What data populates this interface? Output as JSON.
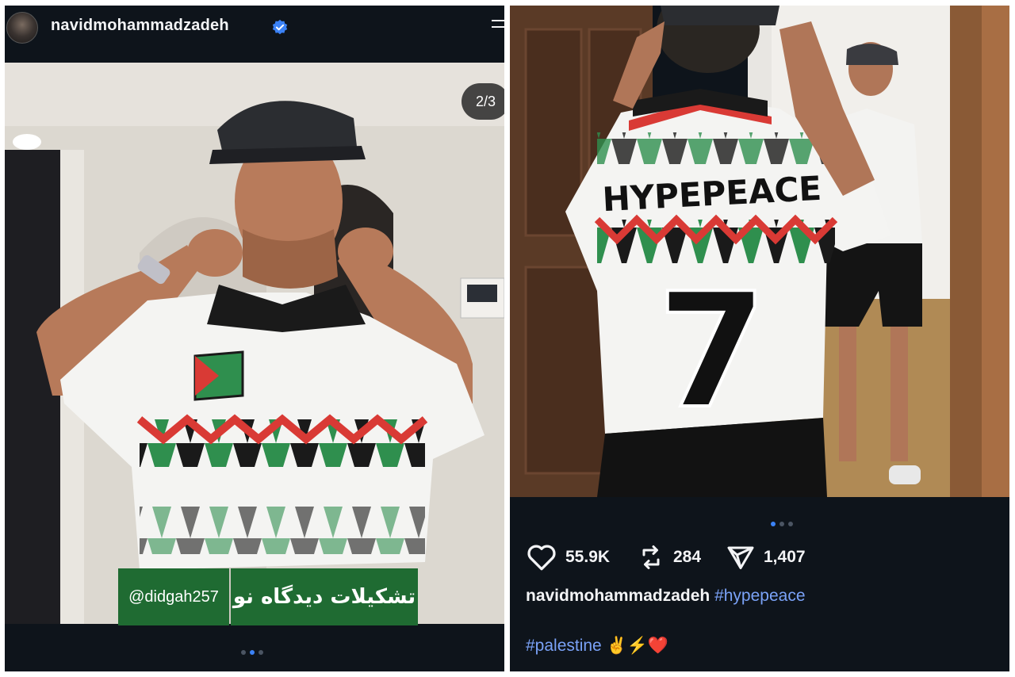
{
  "left_post": {
    "username": "navidmohammadzadeh",
    "slide_counter": "2/3",
    "watermark_handle": "@didgah257",
    "watermark_text": "تشکیلات دیدگاه نو",
    "dots": [
      false,
      true,
      false
    ]
  },
  "right_post": {
    "jersey_name": "HYPEPEACE",
    "jersey_number": "7",
    "dots": [
      true,
      false,
      false
    ],
    "likes": "55.9K",
    "reposts": "284",
    "shares": "1,407",
    "caption_user": "navidmohammadzadeh",
    "caption_tag1": "#hypepeace",
    "caption_tag2": "#palestine",
    "caption_emojis": "✌️⚡❤️"
  },
  "icons": {
    "verified": "verified-badge-icon",
    "menu": "menu-icon",
    "like": "heart-icon",
    "repost": "repost-icon",
    "share": "send-icon"
  },
  "colors": {
    "background": "#0e141b",
    "accent": "#3b82f6",
    "hashtag": "#7aa2f7",
    "caption_green": "#1f6b32"
  }
}
